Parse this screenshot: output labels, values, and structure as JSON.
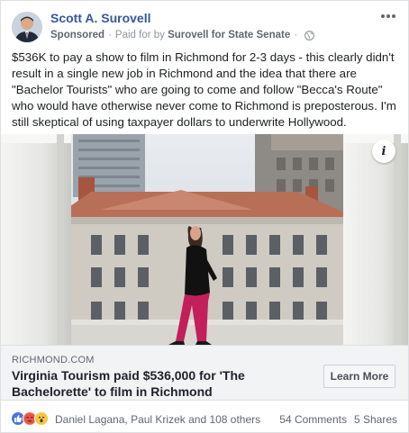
{
  "post": {
    "author": "Scott A. Surovell",
    "sponsored_label": "Sponsored",
    "paid_for_prefix": "Paid for by",
    "paid_for_name": "Surovell for State Senate",
    "text": "$536K to pay a show to film in Richmond for 2-3 days - this clearly didn't result in a single new job in Richmond and the idea that there are \"Bachelor Tourists\" who are going to come and follow \"Becca's Route\" who would have otherwise never come to Richmond is preposterous. I'm still skeptical of using taxpayer dollars to underwrite Hollywood."
  },
  "link": {
    "domain": "RICHMOND.COM",
    "headline": "Virginia Tourism paid $536,000 for 'The Bachelorette' to film in Richmond",
    "cta": "Learn More",
    "info_glyph": "i"
  },
  "footer": {
    "reactors": "Daniel Lagana, Paul Krizek and 108 others",
    "comments": "54 Comments",
    "shares": "5 Shares"
  },
  "colors": {
    "name_link": "#365899",
    "like": "#4a76de",
    "angry": "#f0773a",
    "wow": "#f7c642"
  },
  "icons": [
    "avatar",
    "more-options-icon",
    "globe-icon",
    "info-icon",
    "like-reaction-icon",
    "angry-reaction-icon",
    "wow-reaction-icon"
  ]
}
